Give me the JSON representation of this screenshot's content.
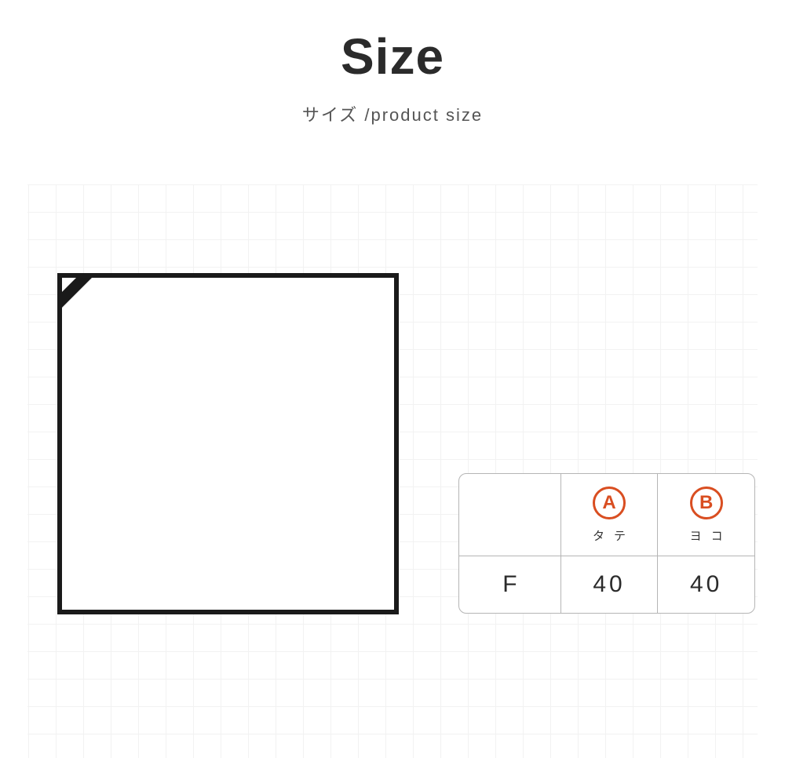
{
  "header": {
    "title": "Size",
    "subtitle": "サイズ /product size"
  },
  "table": {
    "colA": {
      "badge": "A",
      "label": "タテ"
    },
    "colB": {
      "badge": "B",
      "label": "ヨコ"
    },
    "row": {
      "size_label": "F",
      "a_value": "40",
      "b_value": "40"
    }
  }
}
